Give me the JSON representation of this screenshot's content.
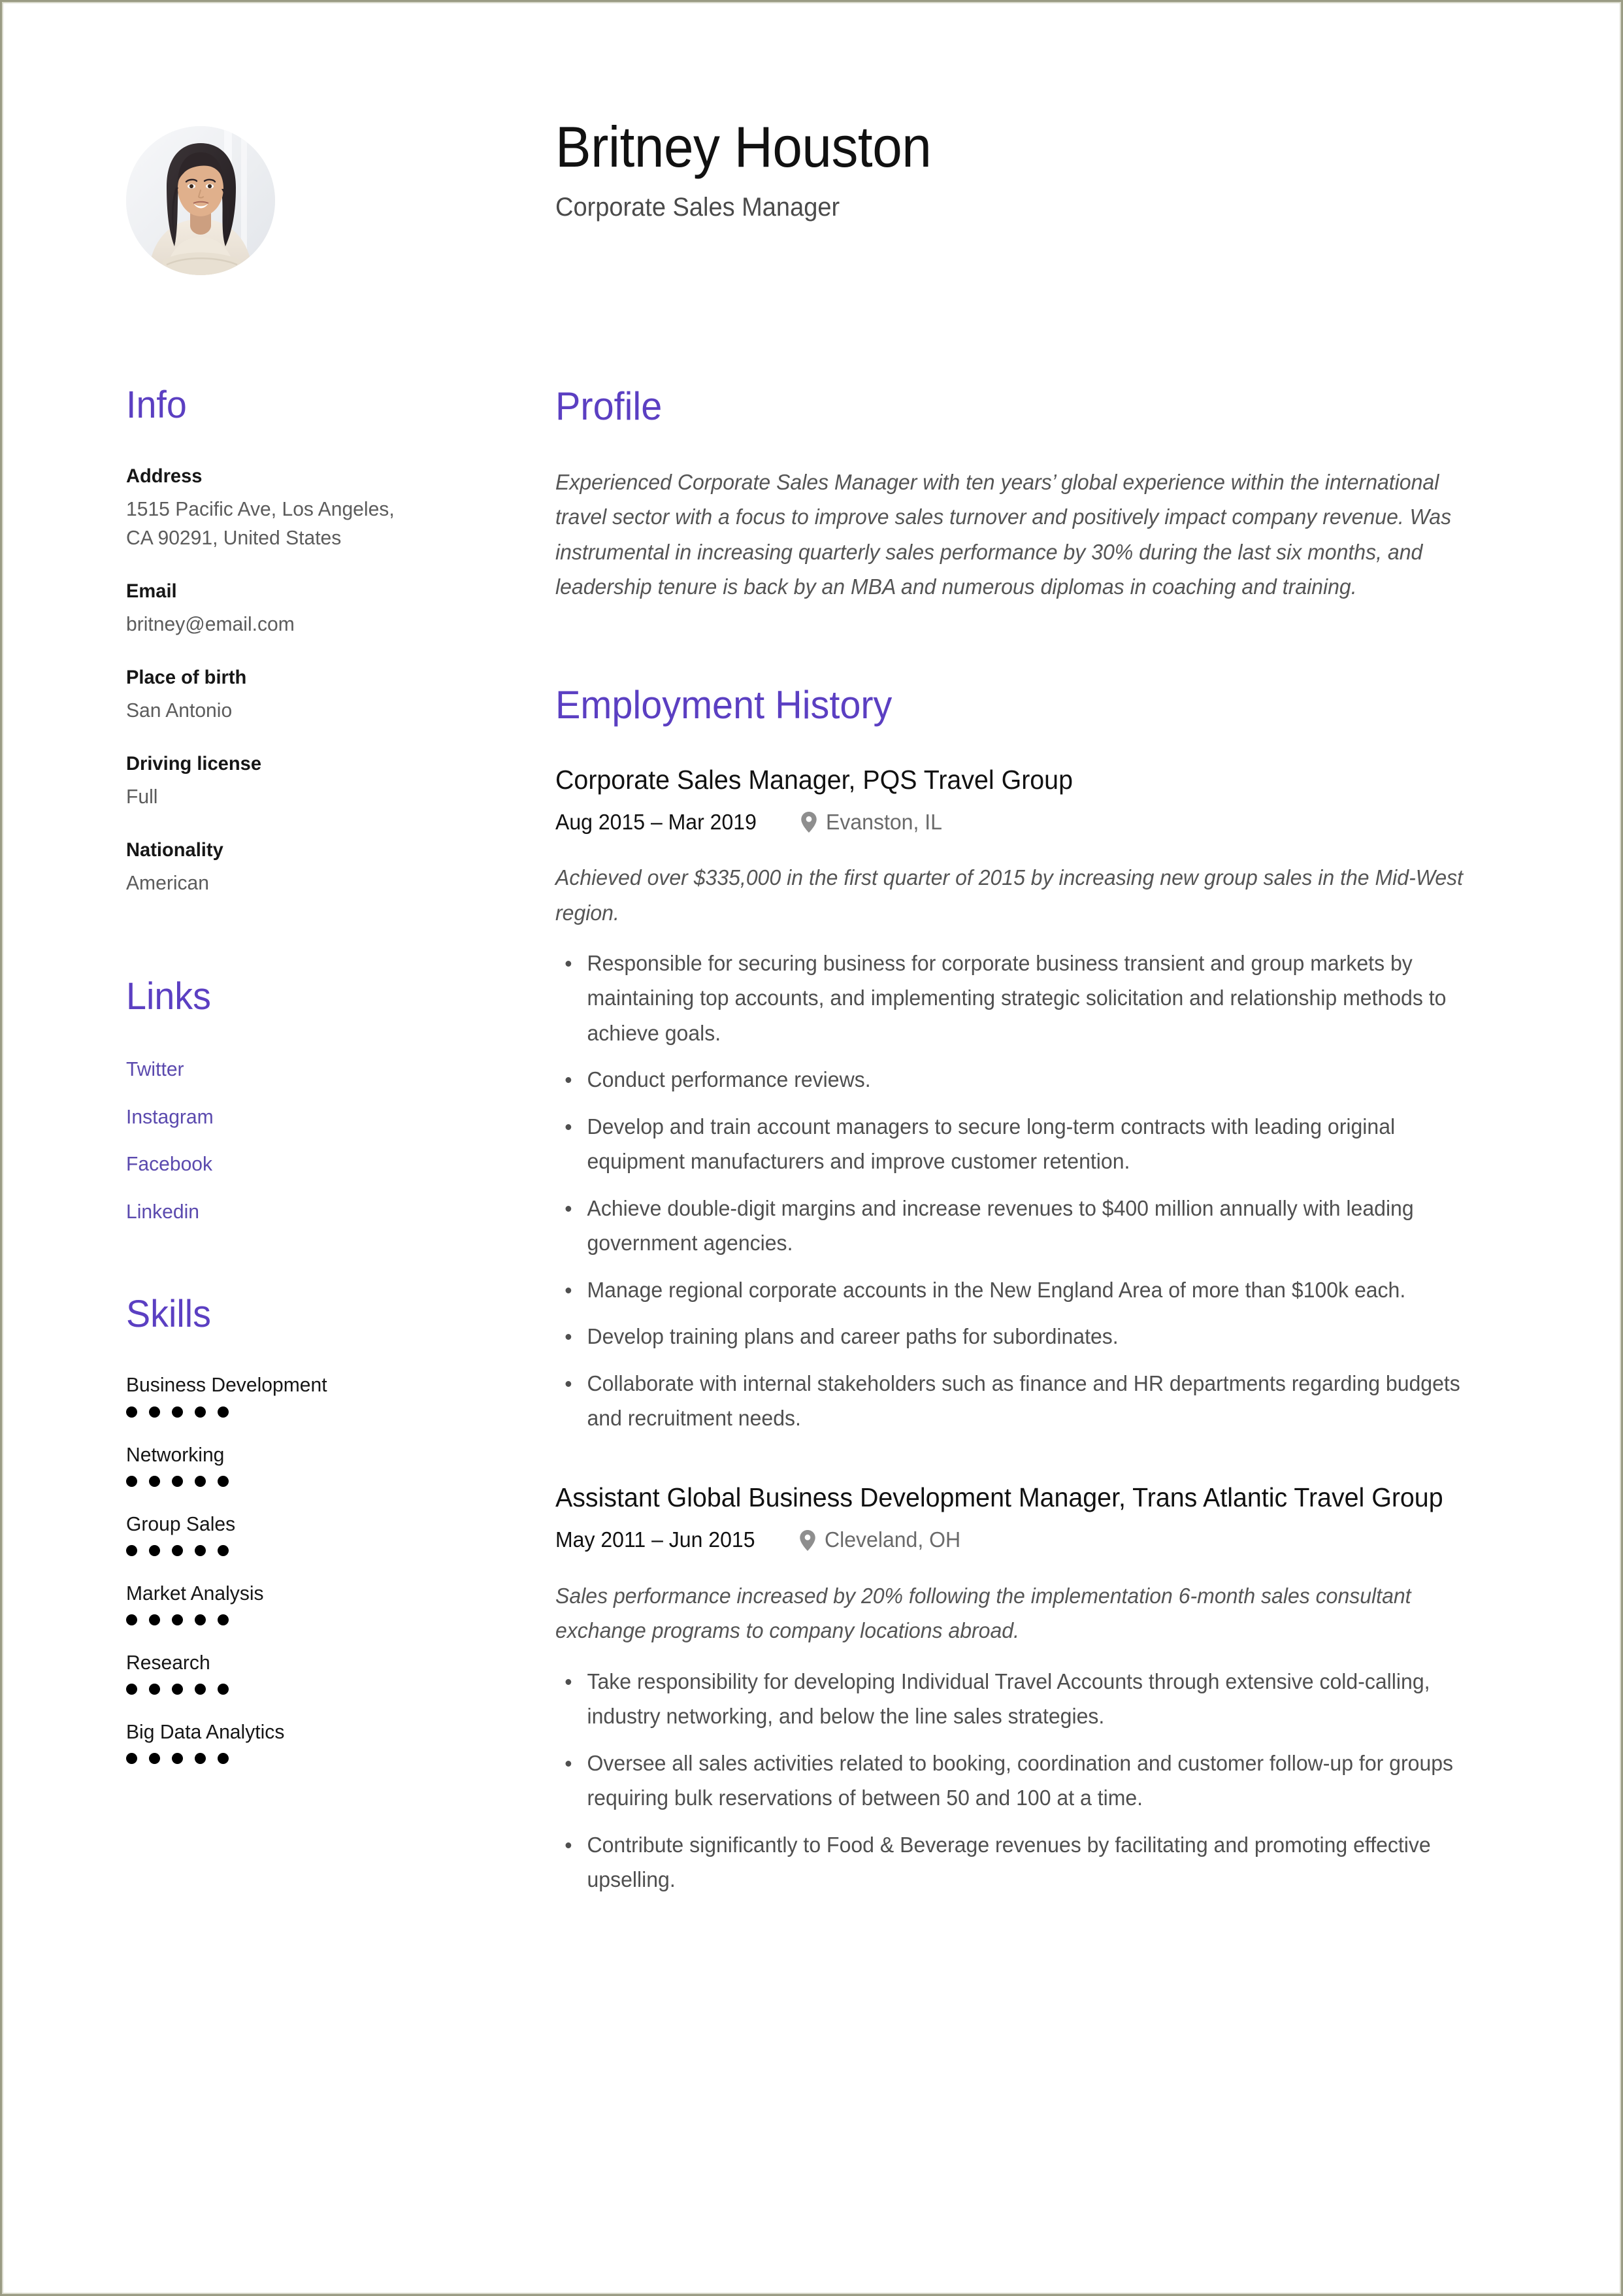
{
  "theme": {
    "accent_purple": "#5B3FC2",
    "link_purple": "#5B4AAE",
    "body_grey": "#4f4f4f",
    "muted_grey": "#5c5c5c",
    "heading_black": "#111111"
  },
  "header": {
    "full_name": "Britney Houston",
    "job_title": "Corporate Sales Manager",
    "avatar_alt": "portrait-photo"
  },
  "sidebar": {
    "info": {
      "heading": "Info",
      "items": [
        {
          "label": "Address",
          "value": "1515 Pacific Ave, Los Angeles, CA 90291, United States"
        },
        {
          "label": "Email",
          "value": "britney@email.com"
        },
        {
          "label": "Place of birth",
          "value": "San Antonio"
        },
        {
          "label": "Driving license",
          "value": "Full"
        },
        {
          "label": "Nationality",
          "value": "American"
        }
      ]
    },
    "links": {
      "heading": "Links",
      "items": [
        {
          "label": "Twitter"
        },
        {
          "label": "Instagram"
        },
        {
          "label": "Facebook"
        },
        {
          "label": "Linkedin"
        }
      ]
    },
    "skills": {
      "heading": "Skills",
      "max_rating": 5,
      "items": [
        {
          "name": "Business Development",
          "rating": 5
        },
        {
          "name": "Networking",
          "rating": 5
        },
        {
          "name": "Group Sales",
          "rating": 5
        },
        {
          "name": "Market Analysis",
          "rating": 5
        },
        {
          "name": "Research",
          "rating": 5
        },
        {
          "name": "Big Data Analytics",
          "rating": 5
        }
      ]
    }
  },
  "main": {
    "profile": {
      "heading": "Profile",
      "text": "Experienced Corporate Sales Manager with ten years’ global experience within the international travel sector with a focus to improve sales turnover and positively impact company revenue. Was instrumental in increasing quarterly sales performance by 30% during the last six months, and leadership tenure is back by an MBA and numerous diplomas in coaching and training."
    },
    "employment": {
      "heading": "Employment History",
      "jobs": [
        {
          "title": "Corporate Sales Manager, PQS Travel Group",
          "dates": "Aug 2015 – Mar 2019",
          "location": "Evanston, IL",
          "location_icon": "map-pin-icon",
          "summary": "Achieved over $335,000 in the first quarter of 2015 by increasing new group sales in the Mid-West region.",
          "bullets": [
            "Responsible for securing business for corporate business transient and group markets by maintaining top accounts, and implementing strategic solicitation and relationship methods to achieve goals.",
            "Conduct performance reviews.",
            "Develop and train account managers to secure long-term contracts with leading original equipment manufacturers and improve customer retention.",
            "Achieve double-digit margins and increase revenues to $400 million annually with leading government agencies.",
            "Manage regional corporate accounts in the New England Area of more than $100k each.",
            "Develop training plans and career paths for subordinates.",
            "Collaborate with internal stakeholders such as finance and HR departments regarding budgets and recruitment needs."
          ]
        },
        {
          "title": "Assistant Global Business Development Manager, Trans Atlantic Travel Group",
          "dates": "May 2011 – Jun 2015",
          "location": "Cleveland, OH",
          "location_icon": "map-pin-icon",
          "summary": "Sales performance increased by 20% following the implementation 6-month sales consultant exchange programs to company locations abroad.",
          "bullets": [
            "Take responsibility for developing Individual Travel Accounts through extensive cold-calling, industry networking, and below the line sales strategies.",
            "Oversee all sales activities related to booking, coordination and customer follow-up for groups requiring bulk reservations of between 50 and 100 at a time.",
            "Contribute significantly to Food & Beverage revenues by facilitating and promoting effective upselling."
          ]
        }
      ]
    }
  }
}
